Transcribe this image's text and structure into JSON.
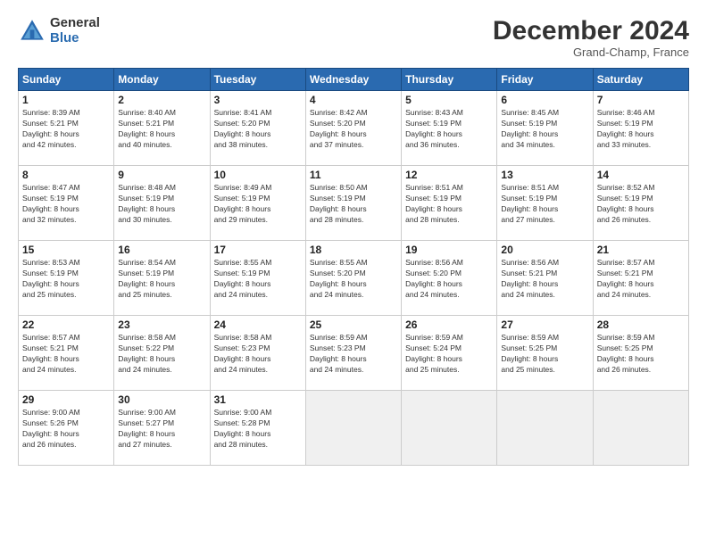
{
  "header": {
    "logo_general": "General",
    "logo_blue": "Blue",
    "month_title": "December 2024",
    "location": "Grand-Champ, France"
  },
  "weekdays": [
    "Sunday",
    "Monday",
    "Tuesday",
    "Wednesday",
    "Thursday",
    "Friday",
    "Saturday"
  ],
  "weeks": [
    [
      {
        "day": 1,
        "sunrise": "8:39 AM",
        "sunset": "5:21 PM",
        "daylight": "8 hours and 42 minutes."
      },
      {
        "day": 2,
        "sunrise": "8:40 AM",
        "sunset": "5:21 PM",
        "daylight": "8 hours and 40 minutes."
      },
      {
        "day": 3,
        "sunrise": "8:41 AM",
        "sunset": "5:20 PM",
        "daylight": "8 hours and 38 minutes."
      },
      {
        "day": 4,
        "sunrise": "8:42 AM",
        "sunset": "5:20 PM",
        "daylight": "8 hours and 37 minutes."
      },
      {
        "day": 5,
        "sunrise": "8:43 AM",
        "sunset": "5:19 PM",
        "daylight": "8 hours and 36 minutes."
      },
      {
        "day": 6,
        "sunrise": "8:45 AM",
        "sunset": "5:19 PM",
        "daylight": "8 hours and 34 minutes."
      },
      {
        "day": 7,
        "sunrise": "8:46 AM",
        "sunset": "5:19 PM",
        "daylight": "8 hours and 33 minutes."
      }
    ],
    [
      {
        "day": 8,
        "sunrise": "8:47 AM",
        "sunset": "5:19 PM",
        "daylight": "8 hours and 32 minutes."
      },
      {
        "day": 9,
        "sunrise": "8:48 AM",
        "sunset": "5:19 PM",
        "daylight": "8 hours and 30 minutes."
      },
      {
        "day": 10,
        "sunrise": "8:49 AM",
        "sunset": "5:19 PM",
        "daylight": "8 hours and 29 minutes."
      },
      {
        "day": 11,
        "sunrise": "8:50 AM",
        "sunset": "5:19 PM",
        "daylight": "8 hours and 28 minutes."
      },
      {
        "day": 12,
        "sunrise": "8:51 AM",
        "sunset": "5:19 PM",
        "daylight": "8 hours and 28 minutes."
      },
      {
        "day": 13,
        "sunrise": "8:51 AM",
        "sunset": "5:19 PM",
        "daylight": "8 hours and 27 minutes."
      },
      {
        "day": 14,
        "sunrise": "8:52 AM",
        "sunset": "5:19 PM",
        "daylight": "8 hours and 26 minutes."
      }
    ],
    [
      {
        "day": 15,
        "sunrise": "8:53 AM",
        "sunset": "5:19 PM",
        "daylight": "8 hours and 25 minutes."
      },
      {
        "day": 16,
        "sunrise": "8:54 AM",
        "sunset": "5:19 PM",
        "daylight": "8 hours and 25 minutes."
      },
      {
        "day": 17,
        "sunrise": "8:55 AM",
        "sunset": "5:19 PM",
        "daylight": "8 hours and 24 minutes."
      },
      {
        "day": 18,
        "sunrise": "8:55 AM",
        "sunset": "5:20 PM",
        "daylight": "8 hours and 24 minutes."
      },
      {
        "day": 19,
        "sunrise": "8:56 AM",
        "sunset": "5:20 PM",
        "daylight": "8 hours and 24 minutes."
      },
      {
        "day": 20,
        "sunrise": "8:56 AM",
        "sunset": "5:21 PM",
        "daylight": "8 hours and 24 minutes."
      },
      {
        "day": 21,
        "sunrise": "8:57 AM",
        "sunset": "5:21 PM",
        "daylight": "8 hours and 24 minutes."
      }
    ],
    [
      {
        "day": 22,
        "sunrise": "8:57 AM",
        "sunset": "5:21 PM",
        "daylight": "8 hours and 24 minutes."
      },
      {
        "day": 23,
        "sunrise": "8:58 AM",
        "sunset": "5:22 PM",
        "daylight": "8 hours and 24 minutes."
      },
      {
        "day": 24,
        "sunrise": "8:58 AM",
        "sunset": "5:23 PM",
        "daylight": "8 hours and 24 minutes."
      },
      {
        "day": 25,
        "sunrise": "8:59 AM",
        "sunset": "5:23 PM",
        "daylight": "8 hours and 24 minutes."
      },
      {
        "day": 26,
        "sunrise": "8:59 AM",
        "sunset": "5:24 PM",
        "daylight": "8 hours and 25 minutes."
      },
      {
        "day": 27,
        "sunrise": "8:59 AM",
        "sunset": "5:25 PM",
        "daylight": "8 hours and 25 minutes."
      },
      {
        "day": 28,
        "sunrise": "8:59 AM",
        "sunset": "5:25 PM",
        "daylight": "8 hours and 26 minutes."
      }
    ],
    [
      {
        "day": 29,
        "sunrise": "9:00 AM",
        "sunset": "5:26 PM",
        "daylight": "8 hours and 26 minutes."
      },
      {
        "day": 30,
        "sunrise": "9:00 AM",
        "sunset": "5:27 PM",
        "daylight": "8 hours and 27 minutes."
      },
      {
        "day": 31,
        "sunrise": "9:00 AM",
        "sunset": "5:28 PM",
        "daylight": "8 hours and 28 minutes."
      },
      null,
      null,
      null,
      null
    ]
  ]
}
